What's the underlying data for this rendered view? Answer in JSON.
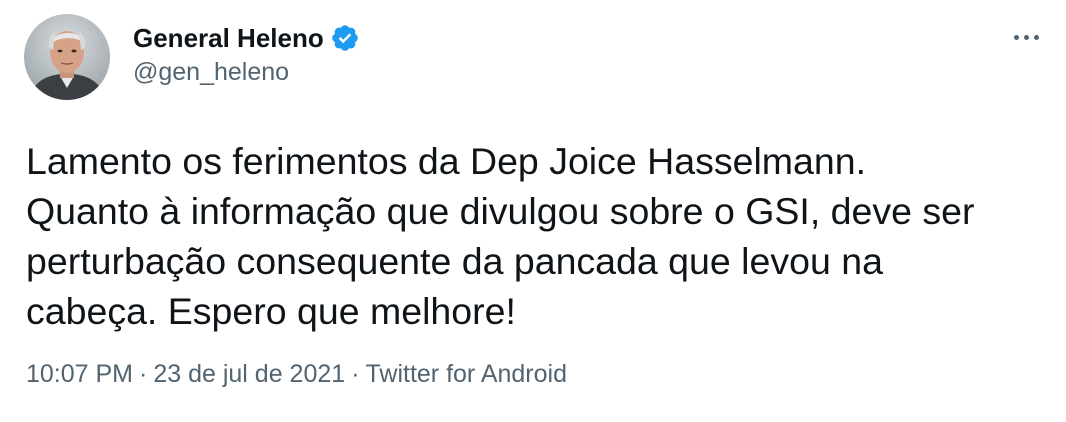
{
  "author": {
    "display_name": "General Heleno",
    "handle": "@gen_heleno",
    "verified": true,
    "verified_color": "#1d9bf0"
  },
  "tweet": {
    "text_lines": [
      "Lamento os ferimentos da Dep Joice Hasselmann.",
      "Quanto à informação que divulgou sobre o GSI, deve ser",
      "perturbação consequente da pancada que levou na",
      "cabeça. Espero que melhore!"
    ]
  },
  "meta": {
    "time": "10:07 PM",
    "separator": "·",
    "date": "23 de jul de 2021",
    "source": "Twitter for Android"
  },
  "icons": {
    "more": "more-horizontal-icon",
    "verified": "verified-badge-icon"
  }
}
